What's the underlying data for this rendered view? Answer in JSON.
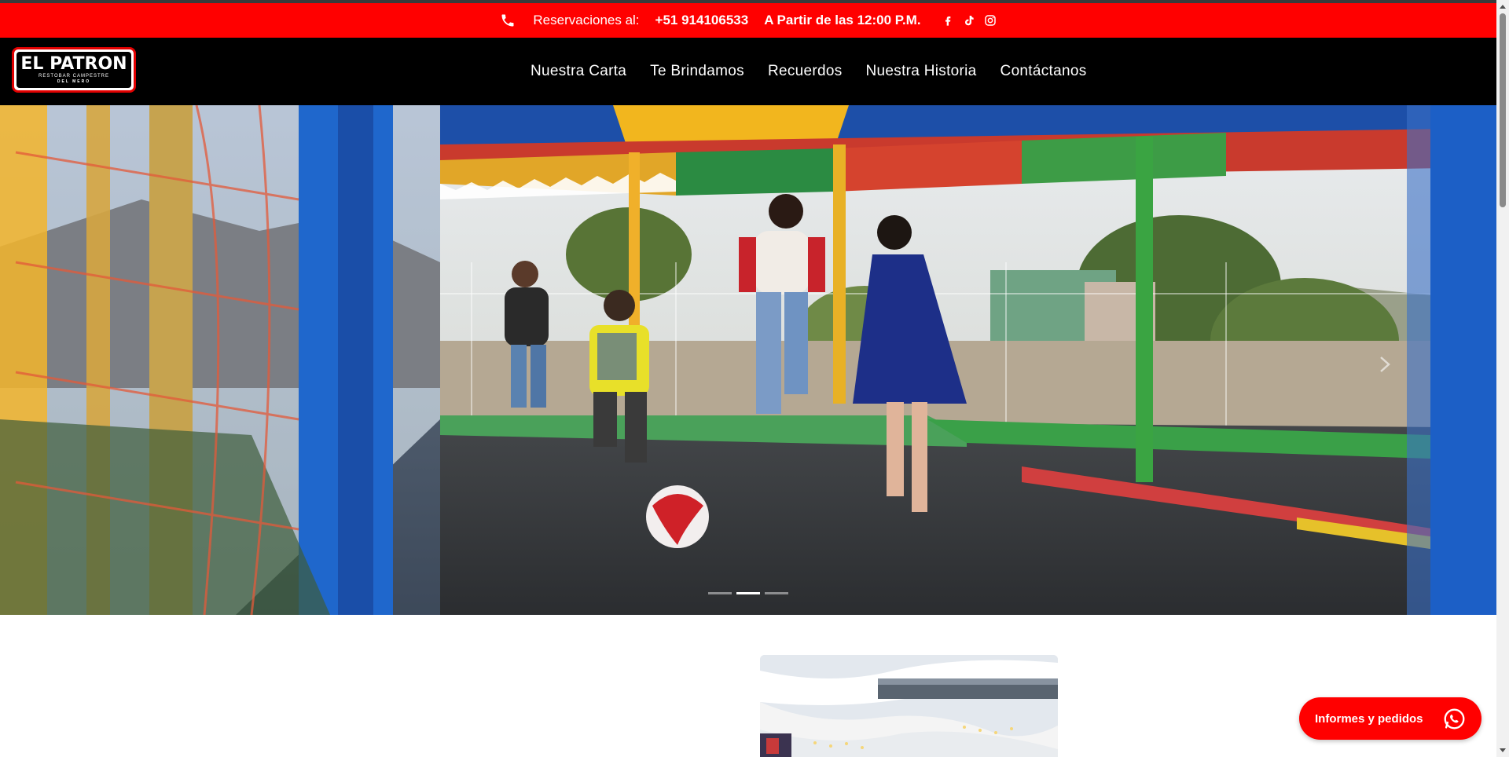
{
  "topbar": {
    "reservations_label": "Reservaciones al:",
    "phone": "+51 914106533",
    "hours": "A Partir de las 12:00 P.M.",
    "social": [
      "facebook-icon",
      "tiktok-icon",
      "instagram-icon"
    ]
  },
  "brand": {
    "logo_text": "EL PATRON",
    "logo_sub": "RESTOBAR CAMPESTRE",
    "logo_sub2": "DEL MERO"
  },
  "nav": {
    "items": [
      "Nuestra Carta",
      "Te Brindamos",
      "Recuerdos",
      "Nuestra Historia",
      "Contáctanos"
    ]
  },
  "hero": {
    "slides": 3,
    "active_slide": 2
  },
  "whatsapp": {
    "label": "Informes y pedidos"
  },
  "colors": {
    "brand_red": "#ff0000",
    "nav_bg": "#000000",
    "text": "#ffffff"
  }
}
